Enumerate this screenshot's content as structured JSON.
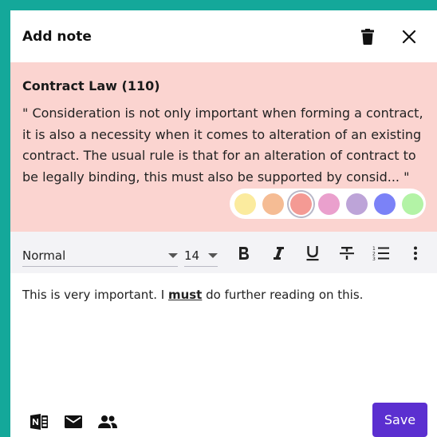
{
  "header": {
    "title": "Add note"
  },
  "quote": {
    "title": "Contract Law (110)",
    "text": "\" Consideration is not only important when forming a contract, it is also a necessity when it comes to alteration of an existing contract. The usual rule is that for an alteration of contract to be legally binding, this must also be supported by consid... \""
  },
  "colors": {
    "background_accent": "#14a89a",
    "quote_background": "#fbd4d0",
    "primary_button": "#5b2fd0",
    "swatches": [
      "#fbeb9e",
      "#f5bc94",
      "#f49a94",
      "#eaa0cd",
      "#bda4d8",
      "#7b82f7",
      "#b3f3a6"
    ],
    "selected_swatch_index": 2
  },
  "toolbar": {
    "paragraph_style": "Normal",
    "font_size": "14",
    "icons": [
      "bold-icon",
      "italic-icon",
      "underline-icon",
      "strikethrough-icon",
      "numbered-list-icon",
      "more-vertical-icon"
    ]
  },
  "editor": {
    "text_before": "This is very important. I ",
    "emphasis": "must",
    "text_after": " do further reading on this."
  },
  "footer": {
    "icons": [
      "onenote-icon",
      "mail-icon",
      "people-icon"
    ],
    "save_label": "Save"
  }
}
